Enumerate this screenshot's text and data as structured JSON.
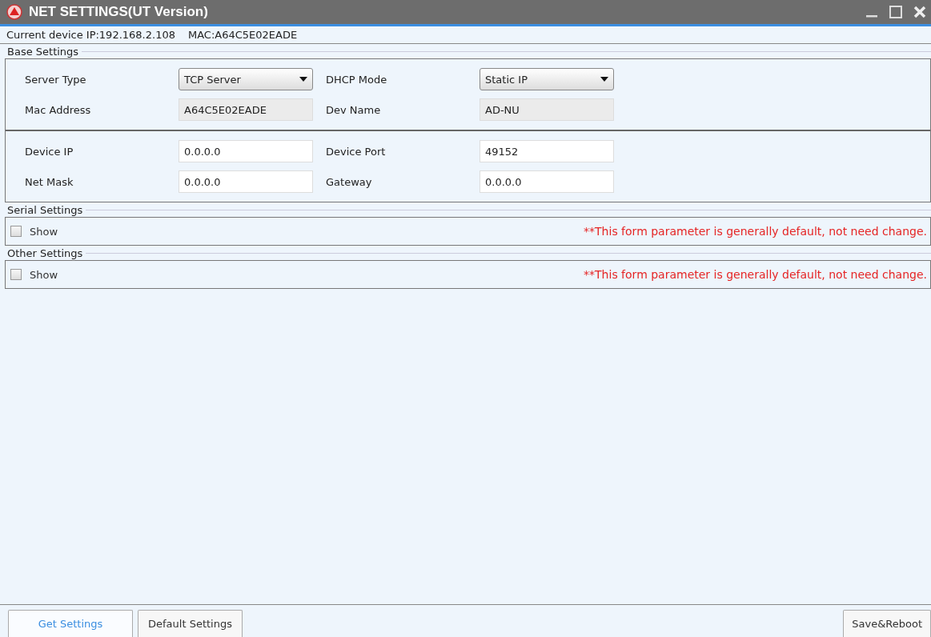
{
  "window": {
    "title": "NET SETTINGS(UT Version)"
  },
  "device_info": {
    "ip": "Current device IP:192.168.2.108",
    "mac": "MAC:A64C5E02EADE"
  },
  "base_settings": {
    "title": "Base Settings",
    "groups": [
      [
        [
          {
            "label": "Server Type",
            "kind": "select",
            "value": "TCP Server"
          },
          {
            "label": "DHCP Mode",
            "kind": "select",
            "value": "Static IP"
          }
        ],
        [
          {
            "label": "Mac Address",
            "kind": "readonly",
            "value": "A64C5E02EADE"
          },
          {
            "label": "Dev Name",
            "kind": "readonly",
            "value": "AD-NU"
          }
        ]
      ],
      [
        [
          {
            "label": "Device IP",
            "kind": "input",
            "value": "0.0.0.0"
          },
          {
            "label": "Device Port",
            "kind": "input",
            "value": "49152"
          }
        ],
        [
          {
            "label": "Net Mask",
            "kind": "input",
            "value": "0.0.0.0"
          },
          {
            "label": "Gateway",
            "kind": "input",
            "value": "0.0.0.0"
          }
        ]
      ]
    ]
  },
  "sections": [
    {
      "title": "Serial Settings",
      "show_label": "Show",
      "checked": false,
      "note": "**This form parameter is generally default, not need change."
    },
    {
      "title": "Other Settings",
      "show_label": "Show",
      "checked": false,
      "note": "**This form parameter is generally default, not need change."
    }
  ],
  "bottom_buttons": [
    {
      "label": "Get Settings",
      "selected": true
    },
    {
      "label": "Default Settings",
      "selected": false
    }
  ],
  "save_button": "Save&Reboot"
}
